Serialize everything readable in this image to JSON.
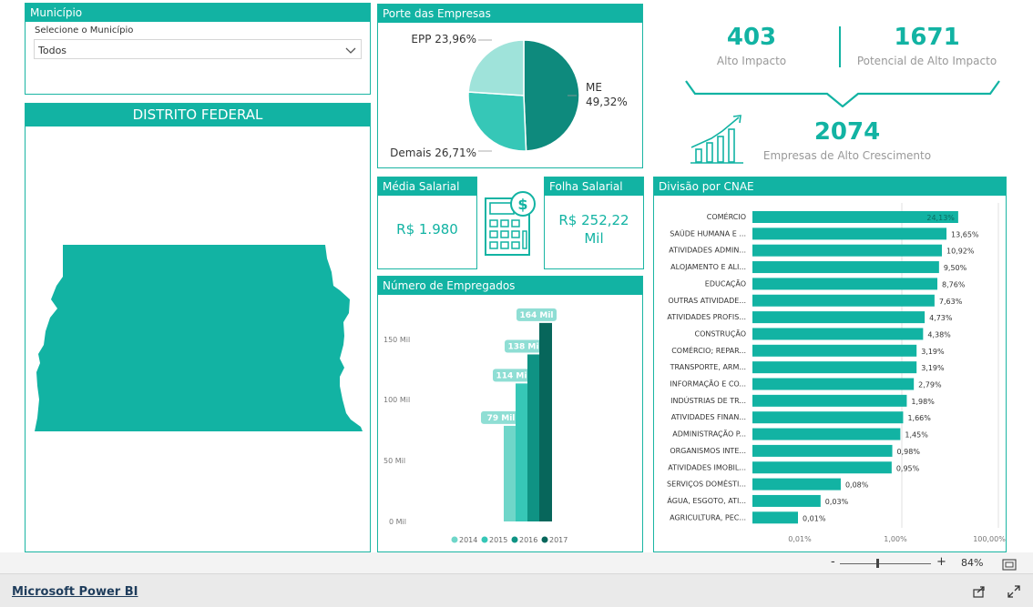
{
  "municipio": {
    "title": "Município",
    "label": "Selecione o Município",
    "value": "Todos"
  },
  "map": {
    "title": "DISTRITO FEDERAL"
  },
  "porte": {
    "title": "Porte das Empresas",
    "slices": [
      {
        "label": "EPP 23,96%",
        "value": 23.96,
        "color": "#9fe3da"
      },
      {
        "label_line1": "ME",
        "label_line2": "49,32%",
        "value": 49.32,
        "color": "#0e8a7d"
      },
      {
        "label": "Demais 26,71%",
        "value": 26.71,
        "color": "#36c7b7"
      }
    ]
  },
  "kpis": {
    "alto_impacto": {
      "value": "403",
      "label": "Alto Impacto"
    },
    "potencial": {
      "value": "1671",
      "label": "Potencial de Alto Impacto"
    },
    "alto_crescimento": {
      "value": "2074",
      "label": "Empresas de Alto Crescimento"
    }
  },
  "media_salarial": {
    "title": "Média Salarial",
    "value": "R$ 1.980"
  },
  "folha_salarial": {
    "title": "Folha Salarial",
    "value_line1": "R$ 252,22",
    "value_line2": "Mil"
  },
  "empregados": {
    "title": "Número de Empregados",
    "y_ticks": [
      "150 Mil",
      "100 Mil",
      "50 Mil",
      "0 Mil"
    ]
  },
  "cnae": {
    "title": "Divisão por CNAE",
    "x_ticks": [
      "0,01%",
      "1,00%",
      "100,00%"
    ]
  },
  "chart_data": [
    {
      "type": "pie",
      "title": "Porte das Empresas",
      "categories": [
        "EPP",
        "ME",
        "Demais"
      ],
      "values": [
        23.96,
        49.32,
        26.71
      ]
    },
    {
      "type": "bar",
      "title": "Número de Empregados",
      "categories": [
        "2014",
        "2015",
        "2016",
        "2017"
      ],
      "values": [
        79,
        114,
        138,
        164
      ],
      "data_labels": [
        "79 Mil",
        "114 Mil",
        "138 Mil",
        "164 Mil"
      ],
      "colors": [
        "#6fd6c9",
        "#36c7b7",
        "#0f9384",
        "#07665b"
      ],
      "ylim": [
        0,
        170
      ],
      "legend": "bottom"
    },
    {
      "type": "bar",
      "title": "Divisão por CNAE",
      "orientation": "horizontal",
      "scale": "log",
      "categories": [
        "COMÉRCIO",
        "SAÚDE HUMANA E ...",
        "ATIVIDADES ADMIN...",
        "ALOJAMENTO E ALI...",
        "EDUCAÇÃO",
        "OUTRAS ATIVIDADE...",
        "ATIVIDADES PROFIS...",
        "CONSTRUÇÃO",
        "COMÉRCIO; REPAR...",
        "TRANSPORTE, ARM...",
        "INFORMAÇÃO E CO...",
        "INDÚSTRIAS DE TR...",
        "ATIVIDADES FINAN...",
        "ADMINISTRAÇÃO P...",
        "ORGANISMOS INTE...",
        "ATIVIDADES IMOBIL...",
        "SERVIÇOS DOMÉSTI...",
        "ÁGUA, ESGOTO, ATI...",
        "AGRICULTURA, PEC..."
      ],
      "values": [
        24.13,
        13.65,
        10.92,
        9.5,
        8.76,
        7.63,
        4.73,
        4.38,
        3.19,
        3.19,
        2.79,
        1.98,
        1.66,
        1.45,
        0.98,
        0.95,
        0.08,
        0.03,
        0.01
      ],
      "data_labels": [
        "24,13%",
        "13,65%",
        "10,92%",
        "9,50%",
        "8,76%",
        "7,63%",
        "4,73%",
        "4,38%",
        "3,19%",
        "3,19%",
        "2,79%",
        "1,98%",
        "1,66%",
        "1,45%",
        "0,98%",
        "0,95%",
        "0,08%",
        "0,03%",
        "0,01%"
      ],
      "xlim": [
        0.01,
        100
      ]
    }
  ],
  "zoom": {
    "minus": "-",
    "plus": "+",
    "level": "84%"
  },
  "footer": {
    "brand": "Microsoft Power BI"
  }
}
